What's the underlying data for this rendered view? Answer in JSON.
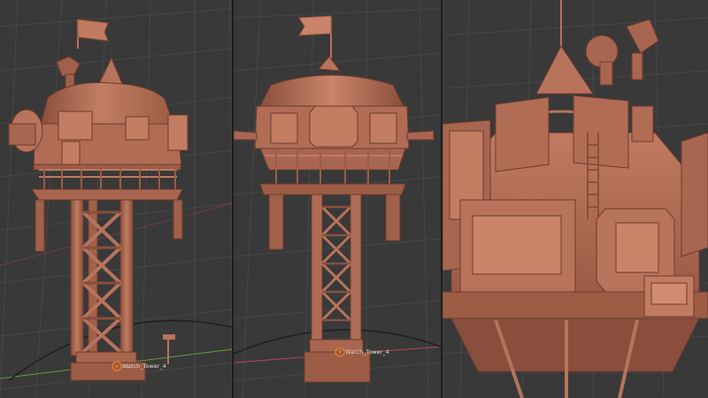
{
  "viewports": [
    {
      "name": "front-view",
      "object_label": "Watch_Tower_4"
    },
    {
      "name": "side-view",
      "object_label": "Watch_Tower_4"
    },
    {
      "name": "closeup-view",
      "object_label": ""
    }
  ],
  "colors": {
    "background": "#393939",
    "grid": "#4a4a4a",
    "clay": "#b8735c",
    "clay_light": "#d08b72",
    "clay_dark": "#8a4f3c",
    "axis_red": "#b5465a",
    "axis_green": "#6d9a3a",
    "origin": "#e07a2a"
  },
  "icons": [
    "flag-icon",
    "origin-marker-icon"
  ]
}
